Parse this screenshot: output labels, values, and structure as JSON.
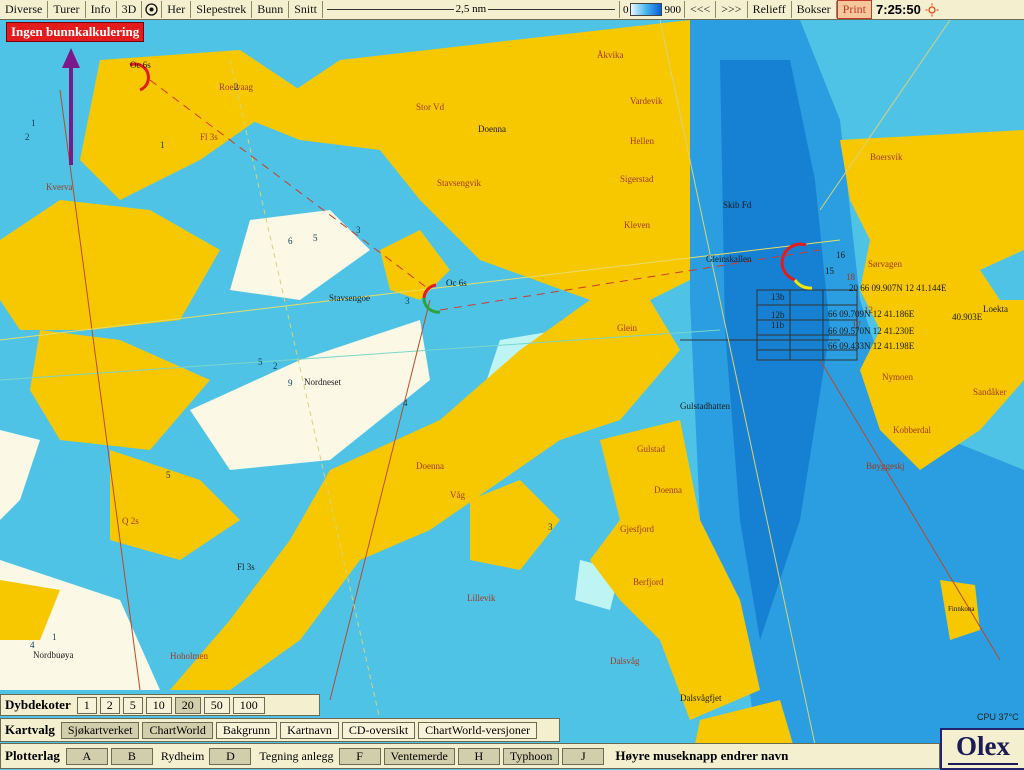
{
  "toolbar": {
    "items": [
      "Diverse",
      "Turer",
      "Info",
      "3D"
    ],
    "here": "Her",
    "items2": [
      "Slepestrek",
      "Bunn",
      "Snitt"
    ],
    "scale_label": "2,5 nm",
    "depth_min": "0",
    "depth_max": "900",
    "nav": [
      "<<<",
      ">>>"
    ],
    "items3": [
      "Relieff",
      "Bokser"
    ],
    "print": "Print",
    "time": "7:25:50"
  },
  "warning": "Ingen bunnkalkulering",
  "panels": {
    "depth_contours": {
      "title": "Dybdekoter",
      "options": [
        "1",
        "2",
        "5",
        "10",
        "20",
        "50",
        "100"
      ],
      "selected": "20"
    },
    "chart_choice": {
      "title": "Kartvalg",
      "options": [
        "Sjøkartverket",
        "ChartWorld",
        "Bakgrunn",
        "Kartnavn",
        "CD-oversikt",
        "ChartWorld-versjoner"
      ],
      "selected": [
        "Sjøkartverket",
        "ChartWorld"
      ]
    },
    "plotter_layers": {
      "title": "Plotterlag",
      "layers": [
        "A",
        "B",
        "Rydheim",
        "D",
        "Tegning anlegg",
        "F",
        "Ventemerde",
        "H",
        "Typhoon",
        "J"
      ],
      "hint": "Høyre museknapp endrer navn"
    }
  },
  "status": {
    "cpu": "CPU 37°C"
  },
  "logo": "Olex",
  "map": {
    "places": [
      "Roelvaag",
      "Kverva",
      "Stor Vd",
      "Doenna",
      "Åkvika",
      "Vardevik",
      "Hellen",
      "Stavsengvik",
      "Sigerstad",
      "Kleven",
      "Skib Fd",
      "Gleinskallen",
      "Stavsengoe",
      "Glein",
      "Nordneset",
      "Gulstadhatten",
      "Gulstad",
      "Doenna",
      "Våg",
      "Doenna",
      "Gjesfjord",
      "Berfjord",
      "Lillevik",
      "Dalsvåg",
      "Dalsvågfjet",
      "Nordbuøya",
      "Hoholmen",
      "Boersvik",
      "Sørvagen",
      "Loekta",
      "Nymoen",
      "Sandåker",
      "Kobberdal",
      "Bøyggeskj",
      "Finnkona"
    ],
    "lights": [
      "Fl 3s",
      "Q 2s",
      "Fl 3s",
      "Oc 6s",
      "Oc 6s"
    ],
    "depths": [
      "1",
      "2",
      "3",
      "5",
      "6",
      "9",
      "5",
      "2",
      "4",
      "1",
      "3",
      "2",
      "4",
      "3",
      "1",
      "5"
    ],
    "marks": [
      "13b",
      "12b",
      "11b",
      "15",
      "16",
      "18",
      "17",
      "12"
    ],
    "readouts": [
      "20 66 09.907N 12 41.144E",
      "66 09.709N 12 41.186E",
      "66 09.570N 12 41.230E",
      "66 09.433N 12 41.198E",
      "40.903E"
    ]
  },
  "colors": {
    "land": "#f7c800",
    "shallow": "#fbf8e6",
    "water": "#4fc3e6",
    "deep": "#1f95de",
    "ui_bg": "#f3efcf",
    "warning": "#e31b1b"
  }
}
